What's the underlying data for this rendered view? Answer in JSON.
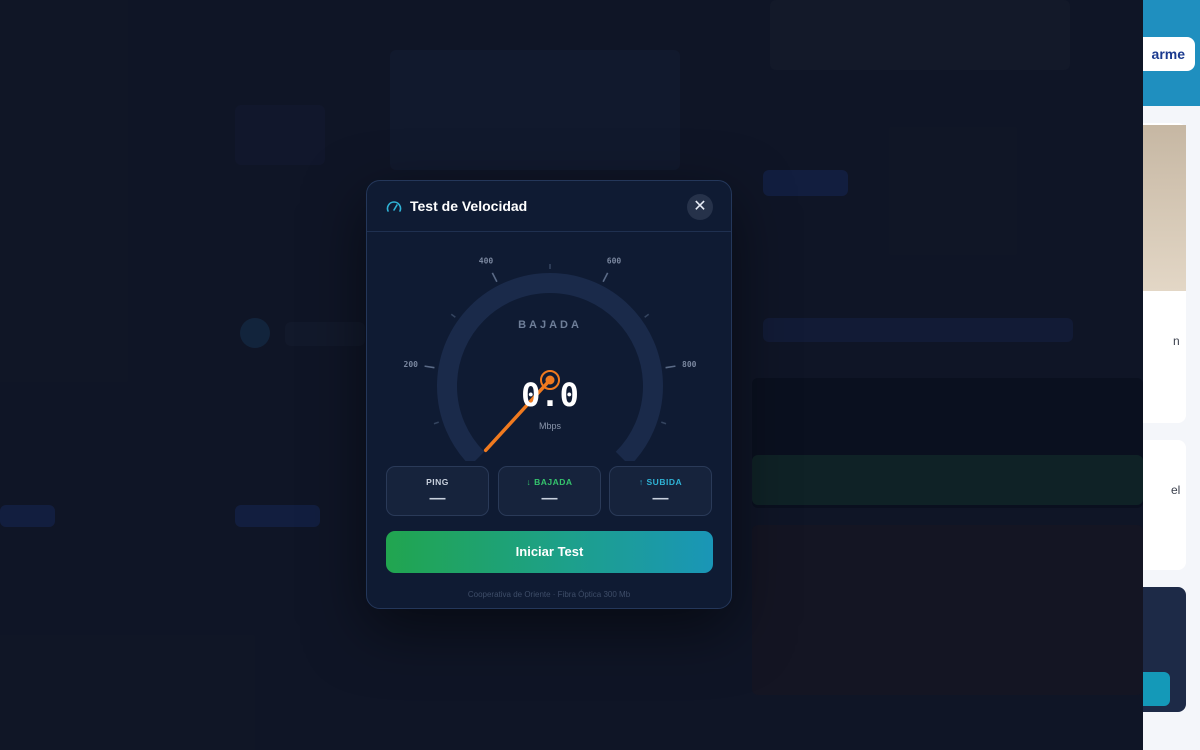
{
  "background": {
    "side_button_label": "arme",
    "side_text_1": "n",
    "side_text_2": "el"
  },
  "modal": {
    "title": "Test de Velocidad",
    "title_icon": "speedometer-icon",
    "close_icon": "close-icon",
    "close_label": "✕",
    "gauge": {
      "mode_label": "BAJADA",
      "value": "0.0",
      "unit": "Mbps",
      "needle_value": 0,
      "scale_max": 1000,
      "tick_labels": [
        "200",
        "400",
        "600",
        "800"
      ],
      "arc_color": "#1a2a4a",
      "needle_color": "#f07a1f"
    },
    "stats": [
      {
        "label": "PING",
        "value": "—",
        "icon": "",
        "color": "#c8d0dd"
      },
      {
        "label": "BAJADA",
        "value": "—",
        "icon": "↓",
        "color": "#35c46d"
      },
      {
        "label": "SUBIDA",
        "value": "—",
        "icon": "↑",
        "color": "#2fb3d6"
      }
    ],
    "start_button_label": "Iniciar Test",
    "footer_note": "Cooperativa de Oriente · Fibra Óptica 300 Mb"
  }
}
